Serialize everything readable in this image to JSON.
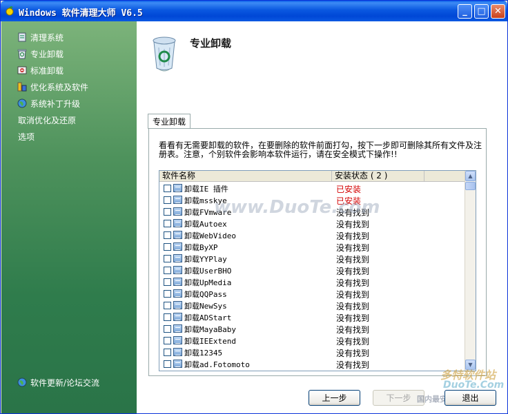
{
  "window": {
    "title": "Windows 软件清理大师 V6.5",
    "minimize_label": "_",
    "maximize_label": "□",
    "close_label": "✕"
  },
  "sidebar": {
    "items": [
      {
        "label": "清理系统",
        "icon": "clean-system-icon"
      },
      {
        "label": "专业卸载",
        "icon": "recycle-bin-icon"
      },
      {
        "label": "标准卸载",
        "icon": "uninstall-icon"
      },
      {
        "label": "优化系统及软件",
        "icon": "optimize-icon"
      },
      {
        "label": "系统补丁升级",
        "icon": "globe-icon"
      },
      {
        "label": "取消优化及还原",
        "icon": ""
      },
      {
        "label": "选项",
        "icon": ""
      }
    ],
    "footer_link": {
      "label": "软件更新/论坛交流",
      "icon": "globe-icon"
    }
  },
  "header": {
    "title": "专业卸载",
    "icon": "recycle-bin-icon"
  },
  "tab": {
    "label": "专业卸载"
  },
  "description": "看看有无需要卸载的软件，在要删除的软件前面打勾，按下一步即可删除其所有文件及注册表。注意，个别软件会影响本软件运行，请在安全模式下操作!!",
  "table": {
    "columns": [
      "软件名称",
      "安装状态 ( 2 )"
    ],
    "rows": [
      {
        "name": "卸载IE 插件",
        "status": "已安装",
        "installed": true
      },
      {
        "name": "卸载msskye",
        "status": "已安装",
        "installed": true
      },
      {
        "name": "卸载FVmware",
        "status": "没有找到",
        "installed": false
      },
      {
        "name": "卸载Autoex",
        "status": "没有找到",
        "installed": false
      },
      {
        "name": "卸载WebVideo",
        "status": "没有找到",
        "installed": false
      },
      {
        "name": "卸载ByXP",
        "status": "没有找到",
        "installed": false
      },
      {
        "name": "卸载YYPlay",
        "status": "没有找到",
        "installed": false
      },
      {
        "name": "卸载UserBHO",
        "status": "没有找到",
        "installed": false
      },
      {
        "name": "卸载UpMedia",
        "status": "没有找到",
        "installed": false
      },
      {
        "name": "卸载QQPass",
        "status": "没有找到",
        "installed": false
      },
      {
        "name": "卸载NewSys",
        "status": "没有找到",
        "installed": false
      },
      {
        "name": "卸载ADStart",
        "status": "没有找到",
        "installed": false
      },
      {
        "name": "卸载MayaBaby",
        "status": "没有找到",
        "installed": false
      },
      {
        "name": "卸载IEExtend",
        "status": "没有找到",
        "installed": false
      },
      {
        "name": "卸载12345",
        "status": "没有找到",
        "installed": false
      },
      {
        "name": "卸载ad.Fotomoto",
        "status": "没有找到",
        "installed": false
      }
    ]
  },
  "buttons": {
    "prev": "上一步",
    "next": "下一步",
    "exit": "退出"
  },
  "watermarks": {
    "center": "www.DuoTe.com",
    "corner_cn": "多特软件站",
    "corner_en": "DuoTe.Com",
    "corner_sub": "国内最安全"
  },
  "colors": {
    "titlebar": "#0a58e0",
    "sidebar_top": "#7cb37a",
    "sidebar_bottom": "#2a7448",
    "installed_text": "#d40000"
  }
}
